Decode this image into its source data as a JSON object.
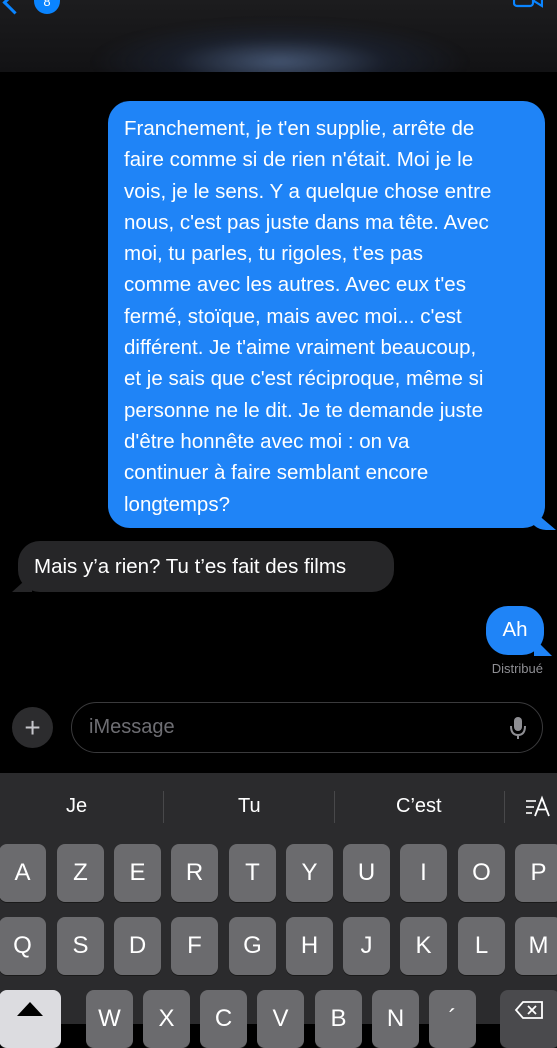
{
  "header": {
    "back_badge": "8"
  },
  "messages": [
    {
      "direction": "sent",
      "text": "Franchement, je t'en supplie, arrête de faire comme si de rien n'était. Moi je le vois, je le sens. Y a quelque chose entre nous, c'est pas juste dans ma tête. Avec moi, tu parles, tu rigoles, t'es pas comme avec les autres. Avec eux t'es fermé, stoïque, mais avec moi... c'est différent. Je t'aime vraiment beaucoup, et je sais que c'est réciproque, même si personne ne le dit. Je te demande juste d'être honnête avec moi : on va continuer à faire semblant encore longtemps?",
      "lines": [
        "Franchement, je t'en supplie, arrête de",
        "faire comme si de rien n'était. Moi je le",
        "vois, je le sens. Y a quelque chose entre",
        "nous, c'est pas juste dans ma tête. Avec",
        "moi, tu parles, tu rigoles, t'es pas",
        "comme avec les autres. Avec eux t'es",
        "fermé, stoïque, mais avec moi... c'est",
        "différent. Je t'aime vraiment beaucoup,",
        "et je sais que c'est réciproque, même si",
        "personne ne le dit. Je te demande juste",
        "d'être honnête avec moi : on va",
        "continuer à faire semblant encore",
        "longtemps?"
      ]
    },
    {
      "direction": "received",
      "text": "Mais y’a rien? Tu t’es fait des films"
    },
    {
      "direction": "sent",
      "text": "Ah"
    }
  ],
  "delivery_status": "Distribué",
  "composer": {
    "plus_label": "+",
    "placeholder": "iMessage"
  },
  "keyboard": {
    "predictions": [
      "Je",
      "Tu",
      "C’est"
    ],
    "format_icon": "text-format-icon",
    "row1": [
      "A",
      "Z",
      "E",
      "R",
      "T",
      "Y",
      "U",
      "I",
      "O",
      "P"
    ],
    "row2": [
      "Q",
      "S",
      "D",
      "F",
      "G",
      "H",
      "J",
      "K",
      "L",
      "M"
    ],
    "row3": [
      "W",
      "X",
      "C",
      "V",
      "B",
      "N",
      "´"
    ]
  },
  "colors": {
    "sent_bubble": "#1f84f7",
    "received_bubble": "#262628",
    "keyboard_bg": "#2b2b2d",
    "key_bg": "#6b6b6e"
  }
}
